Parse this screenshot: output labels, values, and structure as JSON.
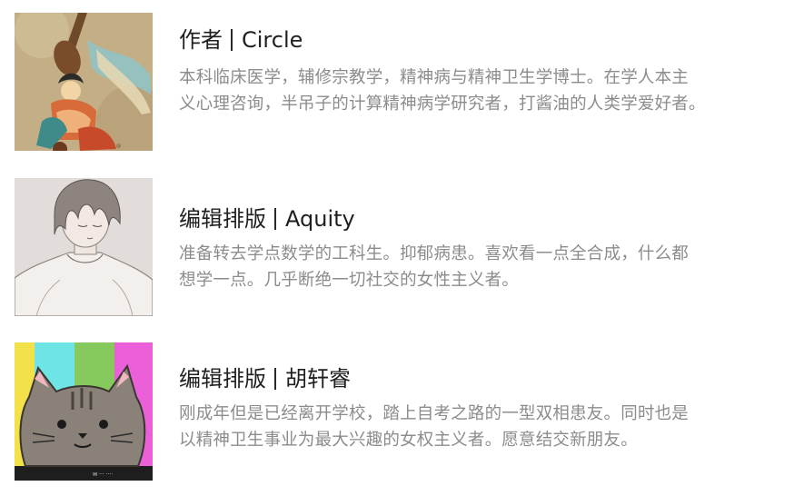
{
  "entries": [
    {
      "role": "作者",
      "name": "Circle",
      "bio_lines": [
        "本科临床医学，辅修宗教学，精神病与精神卫生学博士。在学人本主",
        "义心理咨询，半吊子的计算精神病学研究者，打酱油的人类学爱好者。"
      ],
      "avatar": "dunhuang-fresco-musician"
    },
    {
      "role": "编辑排版",
      "name": "Aquity",
      "bio_lines": [
        "准备转去学点数学的工科生。抑郁病患。喜欢看一点全合成，什么都",
        "想学一点。几乎断绝一切社交的女性主义者。"
      ],
      "avatar": "anime-sketch-boy"
    },
    {
      "role": "编辑排版",
      "name": "胡轩睿",
      "bio_lines": [
        "刚成年但是已经离开学校，踏上自考之路的一型双相患友。同时也是",
        "以精神卫生事业为最大兴趣的女权主义者。愿意结交新朋友。"
      ],
      "avatar": "gray-cat-color-bars"
    }
  ],
  "colors": {
    "name_text": "#1f1f1f",
    "bio_text": "#8c8c8c",
    "background": "#ffffff"
  }
}
